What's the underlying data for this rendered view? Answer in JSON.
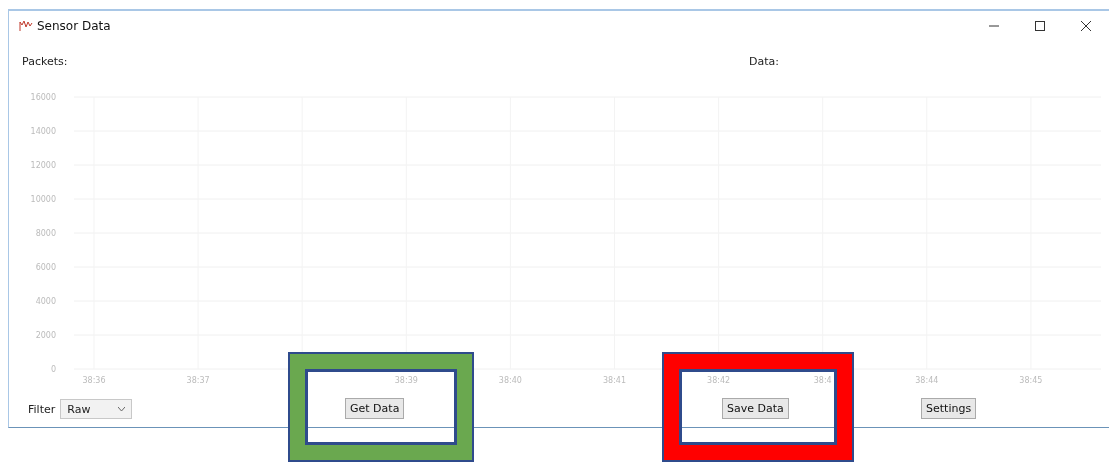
{
  "window": {
    "title": "Sensor Data"
  },
  "labels": {
    "packets": "Packets:",
    "data": "Data:"
  },
  "chart": {
    "chart_data": {
      "type": "line",
      "ylim": [
        0,
        16000
      ],
      "yticks": [
        0,
        2000,
        4000,
        6000,
        8000,
        10000,
        12000,
        14000,
        16000
      ],
      "grid": true,
      "categories": [
        "38:36",
        "38:37",
        null,
        "38:39",
        "38:40",
        "38:41",
        "38:42",
        "38:4",
        "38:44",
        "38:45"
      ]
    }
  },
  "toolbar": {
    "filter_label": "Filter",
    "filter_value": "Raw",
    "buttons": [
      "Get Data",
      "Save Data",
      "Settings"
    ]
  },
  "highlights": [
    {
      "color": "#6aa84f"
    },
    {
      "color": "#ff0000"
    }
  ]
}
